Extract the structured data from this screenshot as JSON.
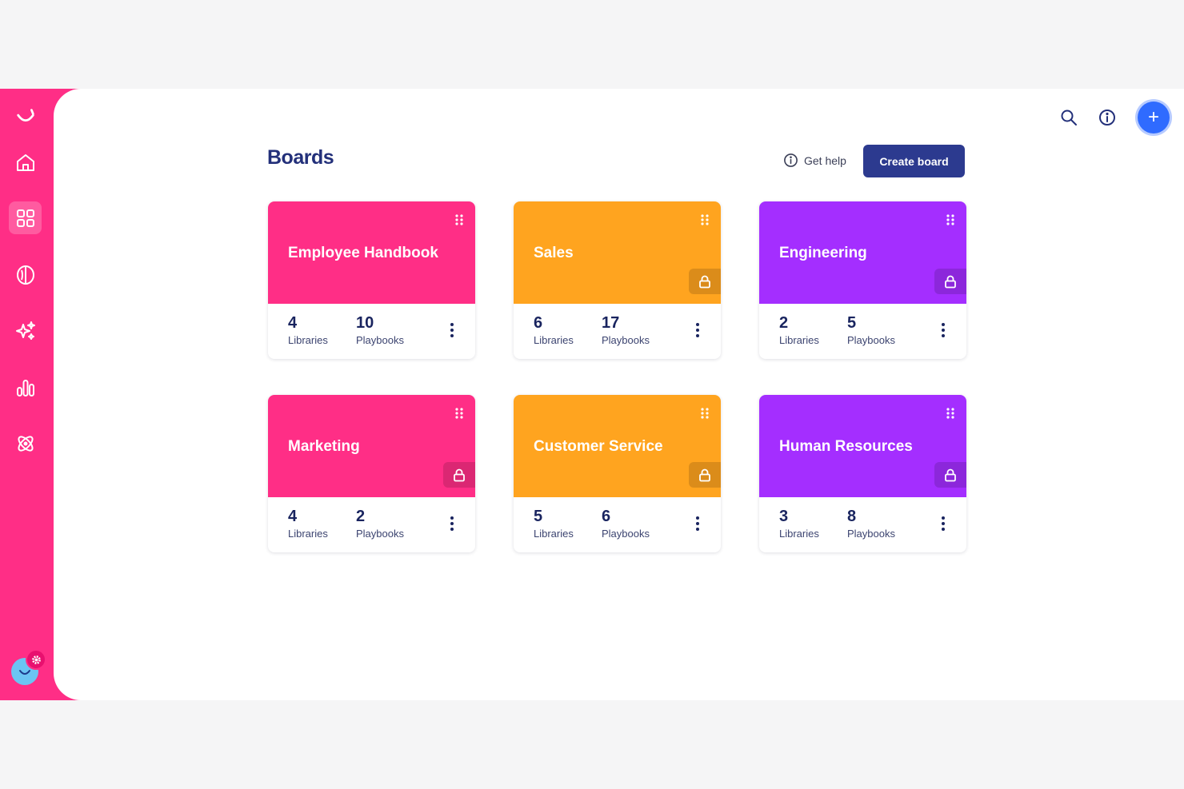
{
  "colors": {
    "brand": "#ff2e86",
    "pink": "#ff2e86",
    "orange": "#ffa41f",
    "purple": "#a42eff",
    "navy": "#2c3a8f"
  },
  "sidebar": {
    "items": [
      {
        "name": "logo",
        "icon": "smile-logo-icon"
      },
      {
        "name": "home",
        "icon": "home-icon"
      },
      {
        "name": "boards",
        "icon": "grid-icon",
        "active": true
      },
      {
        "name": "brain",
        "icon": "brain-icon"
      },
      {
        "name": "ai",
        "icon": "sparkles-icon"
      },
      {
        "name": "analytics",
        "icon": "bar-chart-icon"
      },
      {
        "name": "integrations",
        "icon": "atom-icon"
      }
    ],
    "user": {
      "icon": "user-avatar-icon",
      "badge": "gear-icon"
    }
  },
  "header": {
    "search_icon": "search-icon",
    "info_icon": "info-icon",
    "add_label": "+"
  },
  "page": {
    "title": "Boards",
    "help_label": "Get help",
    "create_label": "Create board"
  },
  "boards": [
    {
      "title": "Employee Handbook",
      "color": "#ff2e86",
      "locked": false,
      "libraries": "4",
      "playbooks": "10",
      "libraries_label": "Libraries",
      "playbooks_label": "Playbooks"
    },
    {
      "title": "Sales",
      "color": "#ffa41f",
      "locked": true,
      "libraries": "6",
      "playbooks": "17",
      "libraries_label": "Libraries",
      "playbooks_label": "Playbooks"
    },
    {
      "title": "Engineering",
      "color": "#a42eff",
      "locked": true,
      "libraries": "2",
      "playbooks": "5",
      "libraries_label": "Libraries",
      "playbooks_label": "Playbooks"
    },
    {
      "title": "Marketing",
      "color": "#ff2e86",
      "locked": true,
      "libraries": "4",
      "playbooks": "2",
      "libraries_label": "Libraries",
      "playbooks_label": "Playbooks"
    },
    {
      "title": "Customer Service",
      "color": "#ffa41f",
      "locked": true,
      "libraries": "5",
      "playbooks": "6",
      "libraries_label": "Libraries",
      "playbooks_label": "Playbooks"
    },
    {
      "title": "Human Resources",
      "color": "#a42eff",
      "locked": true,
      "libraries": "3",
      "playbooks": "8",
      "libraries_label": "Libraries",
      "playbooks_label": "Playbooks"
    }
  ]
}
